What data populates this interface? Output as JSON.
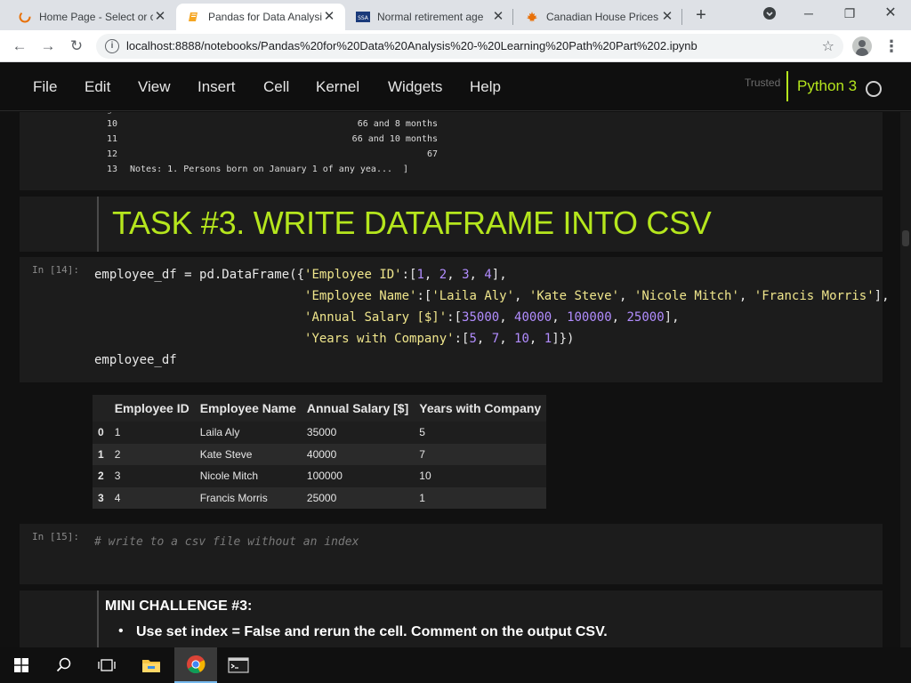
{
  "browser": {
    "tabs": [
      {
        "title": "Home Page - Select or c",
        "icon": "spinner-icon"
      },
      {
        "title": "Pandas for Data Analysis",
        "icon": "jupyter-notebook-icon"
      },
      {
        "title": "Normal retirement age",
        "icon": "ssa-icon",
        "icon_text": "SSA"
      },
      {
        "title": "Canadian House Prices",
        "icon": "maple-leaf-icon"
      }
    ],
    "active_tab": 1,
    "url": "localhost:8888/notebooks/Pandas%20for%20Data%20Analysis%20-%20Learning%20Path%20Part%202.ipynb"
  },
  "jupyter": {
    "menu": [
      "File",
      "Edit",
      "View",
      "Insert",
      "Cell",
      "Kernel",
      "Widgets",
      "Help"
    ],
    "trusted": "Trusted",
    "kernel": "Python 3"
  },
  "prev_output": {
    "rows": [
      {
        "index": "10",
        "value": "66 and 8 months"
      },
      {
        "index": "11",
        "value": "66 and 10 months"
      },
      {
        "index": "12",
        "value": "67"
      },
      {
        "index": "13",
        "value": "Notes: 1. Persons born on January 1 of any yea...  ]"
      }
    ]
  },
  "task3": {
    "heading": "TASK #3. WRITE DATAFRAME INTO CSV"
  },
  "cell14": {
    "prompt": "In [14]:",
    "lines": [
      "employee_df = pd.DataFrame({'Employee ID':[1, 2, 3, 4],",
      "                            'Employee Name':['Laila Aly', 'Kate Steve', 'Nicole Mitch', 'Francis Morris'],",
      "                            'Annual Salary [$]':[35000, 40000, 100000, 25000],",
      "                            'Years with Company':[5, 7, 10, 1]})",
      "employee_df"
    ]
  },
  "dataframe": {
    "columns": [
      "",
      "Employee ID",
      "Employee Name",
      "Annual Salary [$]",
      "Years with Company"
    ],
    "rows": [
      [
        "0",
        "1",
        "Laila Aly",
        "35000",
        "5"
      ],
      [
        "1",
        "2",
        "Kate Steve",
        "40000",
        "7"
      ],
      [
        "2",
        "3",
        "Nicole Mitch",
        "100000",
        "10"
      ],
      [
        "3",
        "4",
        "Francis Morris",
        "25000",
        "1"
      ]
    ]
  },
  "cell15": {
    "prompt": "In [15]:",
    "comment": "# write to a csv file without an index"
  },
  "mini_challenge": {
    "heading": "MINI CHALLENGE #3:",
    "bullets": [
      "Use set index = False and rerun the cell. Comment on the output CSV."
    ]
  },
  "taskbar": {
    "items": [
      "windows-start-icon",
      "search-icon",
      "task-view-icon",
      "file-explorer-icon",
      "chrome-icon",
      "terminal-icon"
    ],
    "active": 4
  },
  "colors": {
    "accent": "#b5e61d",
    "background": "#111111",
    "cell_bg": "#1c1c1c"
  }
}
